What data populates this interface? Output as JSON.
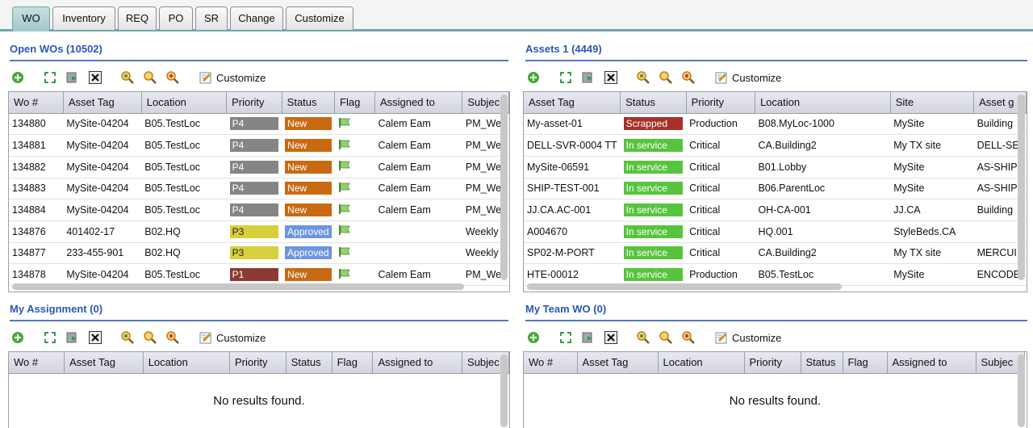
{
  "tabs": [
    {
      "label": "WO",
      "active": true
    },
    {
      "label": "Inventory"
    },
    {
      "label": "REQ"
    },
    {
      "label": "PO"
    },
    {
      "label": "SR"
    },
    {
      "label": "Change"
    },
    {
      "label": "Customize"
    }
  ],
  "toolbar": {
    "customize_label": "Customize"
  },
  "open_wos": {
    "title": "Open WOs (10502)",
    "columns": [
      "Wo #",
      "Asset Tag",
      "Location",
      "Priority",
      "Status",
      "Flag",
      "Assigned to",
      "Subjec"
    ],
    "rows": [
      {
        "wo": "134880",
        "asset": "MySite-04204",
        "location": "B05.TestLoc",
        "priority": "P4",
        "status": "New",
        "assigned": "Calem Eam",
        "subject": "PM_We"
      },
      {
        "wo": "134881",
        "asset": "MySite-04204",
        "location": "B05.TestLoc",
        "priority": "P4",
        "status": "New",
        "assigned": "Calem Eam",
        "subject": "PM_We"
      },
      {
        "wo": "134882",
        "asset": "MySite-04204",
        "location": "B05.TestLoc",
        "priority": "P4",
        "status": "New",
        "assigned": "Calem Eam",
        "subject": "PM_We"
      },
      {
        "wo": "134883",
        "asset": "MySite-04204",
        "location": "B05.TestLoc",
        "priority": "P4",
        "status": "New",
        "assigned": "Calem Eam",
        "subject": "PM_We"
      },
      {
        "wo": "134884",
        "asset": "MySite-04204",
        "location": "B05.TestLoc",
        "priority": "P4",
        "status": "New",
        "assigned": "Calem Eam",
        "subject": "PM_We"
      },
      {
        "wo": "134876",
        "asset": "401402-17",
        "location": "B02.HQ",
        "priority": "P3",
        "status": "Approved",
        "assigned": "",
        "subject": "Weekly"
      },
      {
        "wo": "134877",
        "asset": "233-455-901",
        "location": "B02.HQ",
        "priority": "P3",
        "status": "Approved",
        "assigned": "",
        "subject": "Weekly"
      },
      {
        "wo": "134878",
        "asset": "MySite-04204",
        "location": "B05.TestLoc",
        "priority": "P1",
        "status": "New",
        "assigned": "Calem Eam",
        "subject": "PM_We"
      }
    ]
  },
  "assets": {
    "title": "Assets 1 (4449)",
    "columns": [
      "Asset Tag",
      "Status",
      "Priority",
      "Location",
      "Site",
      "Asset g"
    ],
    "rows": [
      {
        "tag": "My-asset-01",
        "status": "Scrapped",
        "priority": "Production",
        "location": "B08.MyLoc-1000",
        "site": "MySite",
        "group": "Building"
      },
      {
        "tag": "DELL-SVR-0004 TT",
        "status": "In service",
        "priority": "Critical",
        "location": "CA.Building2",
        "site": "My TX site",
        "group": "DELL-SE"
      },
      {
        "tag": "MySite-06591",
        "status": "In service",
        "priority": "Critical",
        "location": "B01.Lobby",
        "site": "MySite",
        "group": "AS-SHIP"
      },
      {
        "tag": "SHIP-TEST-001",
        "status": "In service",
        "priority": "Critical",
        "location": "B06.ParentLoc",
        "site": "MySite",
        "group": "AS-SHIP"
      },
      {
        "tag": "JJ.CA.AC-001",
        "status": "In service",
        "priority": "Critical",
        "location": "OH-CA-001",
        "site": "JJ.CA",
        "group": "Building"
      },
      {
        "tag": "A004670",
        "status": "In service",
        "priority": "Critical",
        "location": "HQ.001",
        "site": "StyleBeds.CA",
        "group": ""
      },
      {
        "tag": "SP02-M-PORT",
        "status": "In service",
        "priority": "Critical",
        "location": "CA.Building2",
        "site": "My TX site",
        "group": "MERCUI"
      },
      {
        "tag": "HTE-00012",
        "status": "In service",
        "priority": "Production",
        "location": "B05.TestLoc",
        "site": "MySite",
        "group": "ENCODE"
      }
    ]
  },
  "my_assignment": {
    "title": "My Assignment (0)",
    "columns": [
      "Wo #",
      "Asset Tag",
      "Location",
      "Priority",
      "Status",
      "Flag",
      "Assigned to",
      "Subjec"
    ],
    "empty": "No results found."
  },
  "my_team": {
    "title": "My Team WO (0)",
    "columns": [
      "Wo #",
      "Asset Tag",
      "Location",
      "Priority",
      "Status",
      "Flag",
      "Assigned to",
      "Subjec"
    ],
    "empty": "No results found."
  },
  "colors": {
    "P4": "#858585",
    "P3": "#d8cf3c",
    "P1": "#8a3a32",
    "New": "#c96a12",
    "Approved": "#6d95e0",
    "Scrapped": "#a8302b",
    "In service": "#58c43e",
    "accent": "#2a57b8"
  },
  "icons": [
    "add-icon",
    "expand-icon",
    "refresh-icon",
    "clear-icon",
    "search-icon",
    "search-zoom-icon",
    "search-clear-icon",
    "customize-icon",
    "flag-icon"
  ]
}
